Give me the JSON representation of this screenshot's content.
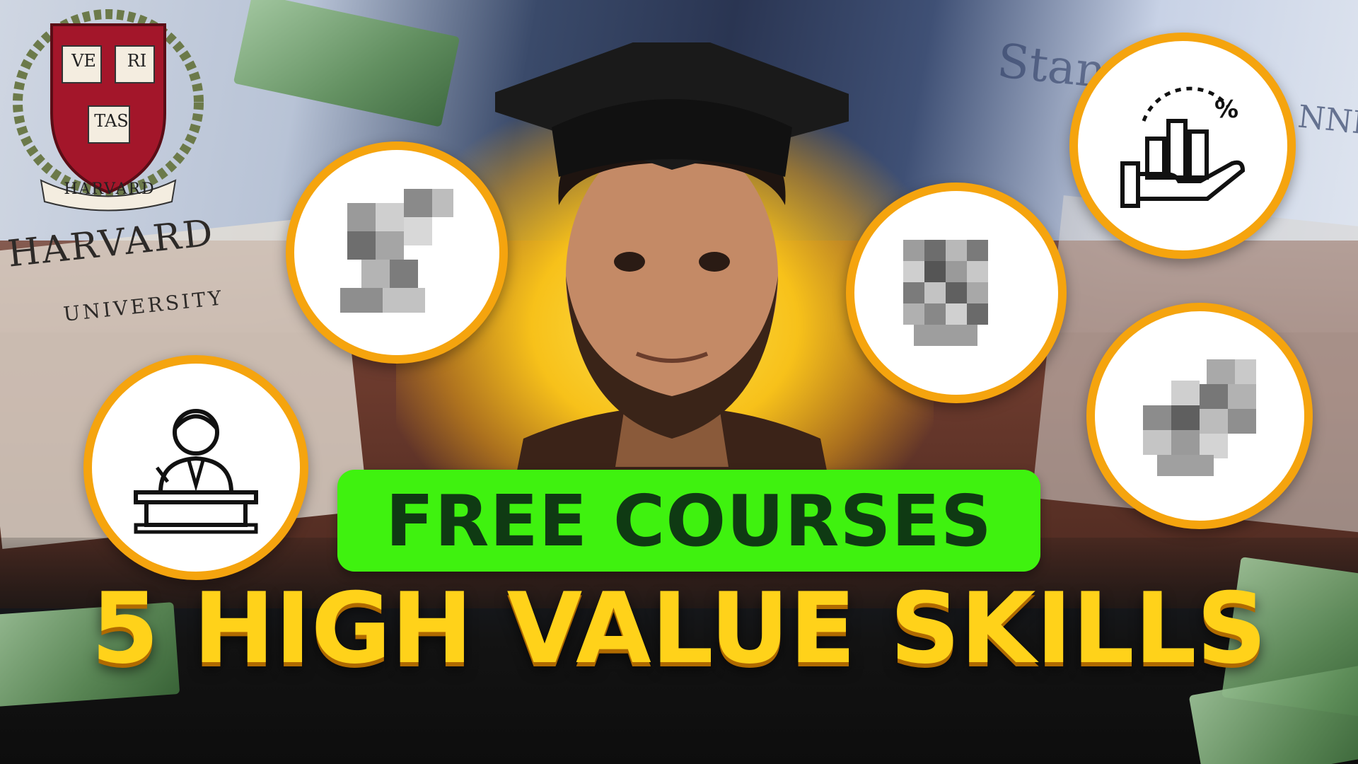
{
  "thumbnail": {
    "badge_text": "FREE COURSES",
    "headline": "5 HIGH VALUE SKILLS",
    "colors": {
      "badge_background": "#3ff20f",
      "badge_text": "#0f3a13",
      "headline": "#ffd21a",
      "circle_border": "#f5a40e",
      "crest_red": "#a3162a"
    }
  },
  "background": {
    "crest_book_labels": [
      "VE",
      "RI",
      "TAS"
    ],
    "crest_banner": "HARVARD",
    "wordmark": "HARVARD",
    "wordmark_sub": "UNIVERSITY",
    "right_partial_word": "Stan",
    "right_partial_word_2": "NNE"
  },
  "icons": [
    {
      "name": "robot-arm-icon",
      "pixelated": true
    },
    {
      "name": "presenter-podium-icon",
      "pixelated": false
    },
    {
      "name": "cpu-chip-icon",
      "pixelated": true
    },
    {
      "name": "bar-chart-hand-percent-icon",
      "pixelated": false
    },
    {
      "name": "handshake-icon",
      "pixelated": true
    }
  ]
}
